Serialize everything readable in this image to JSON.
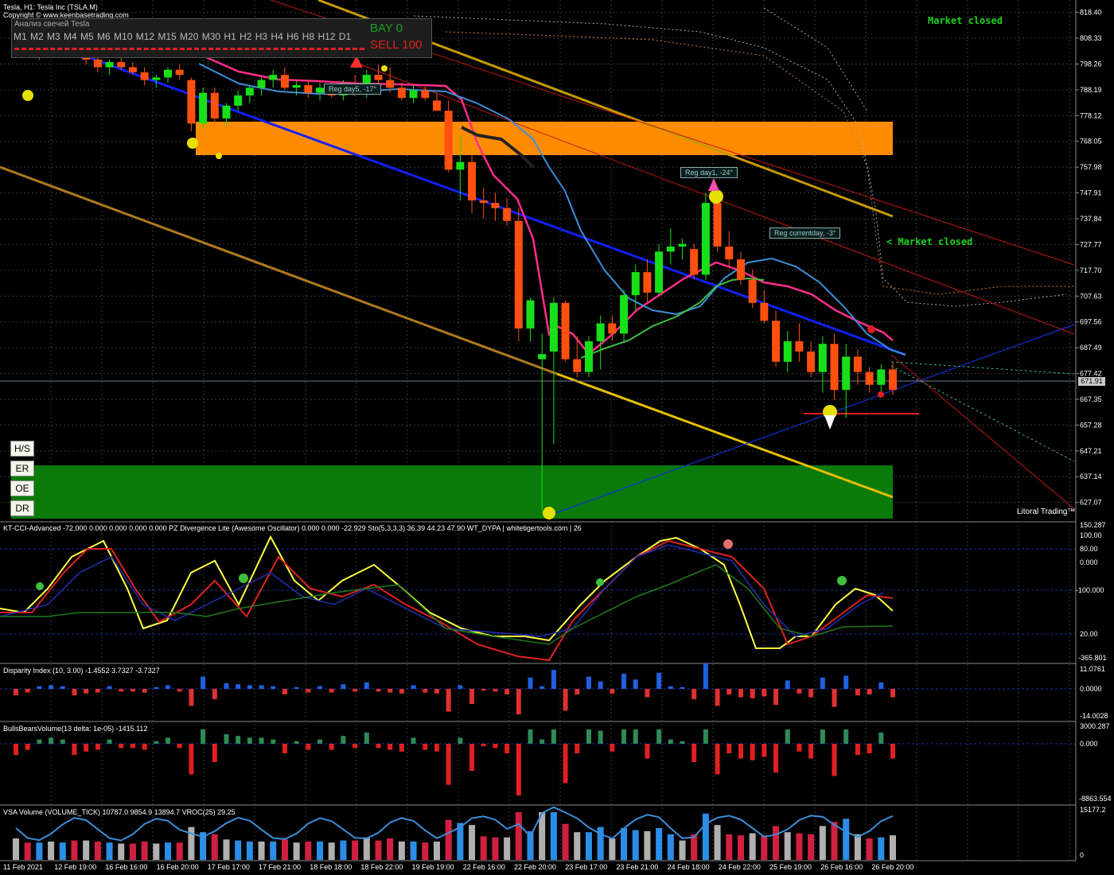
{
  "header": {
    "symbol_line": "Tesla, H1:  Tesla Inc (TSLA.M)",
    "copyright": "Copyright © www.keenbasetrading.com"
  },
  "candle_panel": {
    "title": "Анализ свечей Tesla",
    "timeframes": "M1 M2 M3 M4 M5 M6 M10 M12 M15 M20 M30 H1 H2 H3 H4 H6 H8 H12 D1",
    "bay_label": "BAY  0",
    "sell_label": "SELL 100"
  },
  "status": {
    "market_closed_top": "Market closed",
    "market_closed_mid": "< Market closed",
    "watermark": "Litoral Trading™"
  },
  "side_buttons": [
    "H/S",
    "ER",
    "OE",
    "DR"
  ],
  "reg_labels": {
    "day5": "Reg day5, -17°",
    "day1": "Reg day1, -24°",
    "current": "Reg currentday, -3°"
  },
  "price_axis": {
    "ticks": [
      "818.40",
      "808.33",
      "798.26",
      "788.19",
      "778.12",
      "768.05",
      "757.98",
      "747.91",
      "737.84",
      "727.77",
      "717.70",
      "707.63",
      "697.56",
      "687.49",
      "677.42",
      "667.35",
      "657.28",
      "647.21",
      "637.14",
      "627.07"
    ],
    "current": "671.91"
  },
  "x_axis": [
    "11 Feb 2021",
    "12 Feb 19:00",
    "16 Feb 16:00",
    "16 Feb 20:00",
    "17 Feb 17:00",
    "17 Feb 21:00",
    "18 Feb 18:00",
    "18 Feb 22:00",
    "19 Feb 19:00",
    "22 Feb 16:00",
    "22 Feb 20:00",
    "23 Feb 17:00",
    "23 Feb 21:00",
    "24 Feb 18:00",
    "24 Feb 22:00",
    "25 Feb 19:00",
    "26 Feb 16:00",
    "26 Feb 20:00"
  ],
  "indicators": {
    "cci": {
      "label": "KT-CCI-Advanced -72.000 0.000 0.000 0.000 0.000 PZ Divergence Lite (Awesome Oscillator) 0.000 0.000 -22.929 Sto(5,3,3,3) 36.39 44.23 47.90 WT_DYPA | whitetigertools.com | 26",
      "ticks": [
        "150.287",
        "100.00",
        "80.00",
        "0.000",
        "-100.000",
        "20.00",
        "-365.801"
      ]
    },
    "disparity": {
      "label": "Disparity Index (10, 3.00) -1.4552 3.7327 -3.7327",
      "ticks": [
        "11.0761",
        "0.0000",
        "-14.0028"
      ]
    },
    "bbv": {
      "label": "BullsBearsVolume(13  delta: 1e-05)  -1415.112",
      "ticks": [
        "3000.287",
        "0.000",
        "-8863.554"
      ]
    },
    "vsa": {
      "label": "VSA Volume (VOLUME_TICK) 10787.0 9854.9 13894.7 VROC(25) 29.25",
      "ticks": [
        "15177.2",
        "0"
      ]
    }
  },
  "chart_data": {
    "type": "candlestick",
    "symbol": "TSLA",
    "timeframe": "H1",
    "ylim": [
      622,
      822
    ],
    "candles": [
      [
        812,
        815,
        805,
        806
      ],
      [
        806,
        808,
        802,
        803
      ],
      [
        803,
        806,
        800,
        805
      ],
      [
        805,
        810,
        803,
        808
      ],
      [
        808,
        812,
        806,
        810
      ],
      [
        810,
        811,
        803,
        804
      ],
      [
        804,
        806,
        798,
        800
      ],
      [
        800,
        802,
        795,
        797
      ],
      [
        797,
        800,
        794,
        799
      ],
      [
        799,
        801,
        796,
        797
      ],
      [
        797,
        799,
        794,
        795
      ],
      [
        795,
        797,
        790,
        792
      ],
      [
        792,
        794,
        789,
        793
      ],
      [
        793,
        797,
        791,
        796
      ],
      [
        796,
        798,
        792,
        794
      ],
      [
        792,
        793,
        772,
        775
      ],
      [
        775,
        789,
        773,
        787
      ],
      [
        787,
        789,
        775,
        777
      ],
      [
        777,
        783,
        774,
        782
      ],
      [
        782,
        788,
        780,
        786
      ],
      [
        786,
        790,
        783,
        789
      ],
      [
        789,
        793,
        786,
        792
      ],
      [
        792,
        796,
        789,
        794
      ],
      [
        794,
        797,
        788,
        789
      ],
      [
        789,
        792,
        786,
        790
      ],
      [
        790,
        792,
        785,
        787
      ],
      [
        787,
        791,
        784,
        789
      ],
      [
        789,
        791,
        785,
        786
      ],
      [
        786,
        792,
        784,
        790
      ],
      [
        790,
        794,
        786,
        788
      ],
      [
        788,
        796,
        785,
        794
      ],
      [
        794,
        798,
        790,
        792
      ],
      [
        792,
        797,
        787,
        789
      ],
      [
        789,
        791,
        784,
        785
      ],
      [
        785,
        790,
        783,
        788
      ],
      [
        788,
        790,
        784,
        785
      ],
      [
        784,
        787,
        780,
        780
      ],
      [
        780,
        784,
        756,
        757
      ],
      [
        757,
        770,
        745,
        760
      ],
      [
        760,
        763,
        740,
        745
      ],
      [
        745,
        750,
        738,
        744
      ],
      [
        744,
        748,
        737,
        742
      ],
      [
        742,
        746,
        735,
        737
      ],
      [
        737,
        742,
        690,
        695
      ],
      [
        695,
        707,
        690,
        706
      ],
      [
        683,
        693,
        624,
        685
      ],
      [
        686,
        707,
        650,
        705
      ],
      [
        705,
        706,
        682,
        683
      ],
      [
        683,
        692,
        676,
        678
      ],
      [
        678,
        692,
        676,
        690
      ],
      [
        690,
        700,
        679,
        697
      ],
      [
        697,
        700,
        690,
        693
      ],
      [
        693,
        710,
        690,
        708
      ],
      [
        708,
        720,
        702,
        717
      ],
      [
        717,
        722,
        705,
        709
      ],
      [
        709,
        728,
        708,
        725
      ],
      [
        725,
        734,
        720,
        727
      ],
      [
        727,
        730,
        722,
        728
      ],
      [
        726,
        728,
        714,
        716
      ],
      [
        716,
        748,
        714,
        744
      ],
      [
        744,
        748,
        725,
        727
      ],
      [
        727,
        733,
        719,
        722
      ],
      [
        722,
        725,
        712,
        714
      ],
      [
        714,
        718,
        703,
        705
      ],
      [
        705,
        710,
        697,
        698
      ],
      [
        698,
        702,
        680,
        682
      ],
      [
        682,
        694,
        678,
        690
      ],
      [
        690,
        697,
        682,
        686
      ],
      [
        686,
        690,
        676,
        678
      ],
      [
        678,
        692,
        670,
        689
      ],
      [
        689,
        693,
        667,
        671
      ],
      [
        671,
        689,
        660,
        684
      ],
      [
        684,
        687,
        673,
        678
      ],
      [
        678,
        680,
        670,
        673
      ],
      [
        673,
        681,
        670,
        679
      ],
      [
        679,
        682,
        669,
        671
      ]
    ]
  }
}
